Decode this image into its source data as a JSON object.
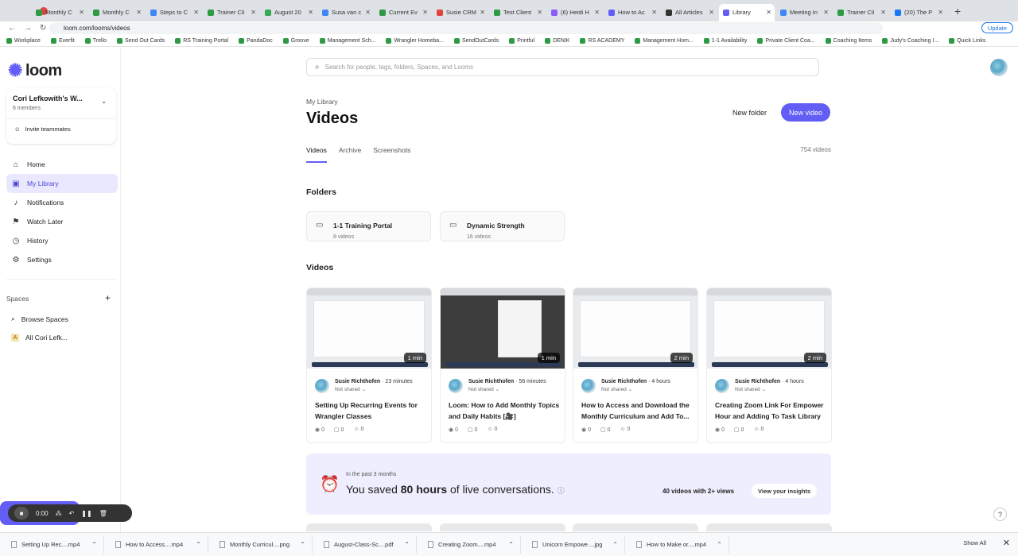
{
  "browser": {
    "tabs": [
      {
        "label": "Monthly C",
        "color": "#2e9a44",
        "active": false
      },
      {
        "label": "Monthly C",
        "color": "#2e9a44",
        "active": false
      },
      {
        "label": "Steps to C",
        "color": "#4285f4",
        "active": false
      },
      {
        "label": "Trainer Cli",
        "color": "#2e9a44",
        "active": false
      },
      {
        "label": "August 20",
        "color": "#34a853",
        "active": false
      },
      {
        "label": "Susa van c",
        "color": "#4285f4",
        "active": false
      },
      {
        "label": "Current Ev",
        "color": "#2e9a44",
        "active": false
      },
      {
        "label": "Susie CRM",
        "color": "#e0443e",
        "active": false
      },
      {
        "label": "Test Client",
        "color": "#2e9a44",
        "active": false
      },
      {
        "label": "(6) Heidi H",
        "color": "#8b5cf6",
        "active": false
      },
      {
        "label": "How to Ac",
        "color": "#625df5",
        "active": false
      },
      {
        "label": "All Articles",
        "color": "#333333",
        "active": false
      },
      {
        "label": "Library",
        "color": "#625df5",
        "active": true
      },
      {
        "label": "Meeting In",
        "color": "#4285f4",
        "active": false
      },
      {
        "label": "Trainer Cli",
        "color": "#2e9a44",
        "active": false
      },
      {
        "label": "(20) The P",
        "color": "#1877f2",
        "active": false
      }
    ],
    "new_tab": "+",
    "url": "loom.com/looms/videos",
    "update_label": "Update",
    "bookmarks": [
      "Workplace",
      "Everfit",
      "Trello",
      "Send Out Cards",
      "RS Training Portal",
      "PandaDoc",
      "Groove",
      "Management Sch...",
      "Wrangler Homeba...",
      "SendOutCards",
      "Printful",
      "DENIK",
      "RS ACADEMY",
      "Management Hom...",
      "1-1 Availability",
      "Private Client Coa...",
      "Coaching Items",
      "Judy's Coaching I...",
      "Quick Links"
    ]
  },
  "sidebar": {
    "logo_text": "loom",
    "workspace_name": "Cori Lefkowith's W...",
    "workspace_members": "6 members",
    "invite_label": "Invite teammates",
    "nav": [
      {
        "label": "Home",
        "icon": "home-icon",
        "glyph": "⌂"
      },
      {
        "label": "My Library",
        "icon": "library-icon",
        "glyph": "▣"
      },
      {
        "label": "Notifications",
        "icon": "bell-icon",
        "glyph": "♪"
      },
      {
        "label": "Watch Later",
        "icon": "bookmark-icon",
        "glyph": "⚑"
      },
      {
        "label": "History",
        "icon": "history-icon",
        "glyph": "◷"
      },
      {
        "label": "Settings",
        "icon": "gear-icon",
        "glyph": "⚙"
      }
    ],
    "spaces_header": "Spaces",
    "browse_spaces": "Browse Spaces",
    "all_space_letter": "A",
    "all_space": "All Cori Lefk..."
  },
  "recorder": {
    "time": "0:00"
  },
  "main": {
    "search_placeholder": "Search for people, tags, folders, Spaces, and Looms",
    "breadcrumb": "My Library",
    "title": "Videos",
    "new_folder": "New folder",
    "new_video": "New video",
    "tabs": [
      "Videos",
      "Archive",
      "Screenshots"
    ],
    "video_count": "754 videos",
    "folders_header": "Folders",
    "folders": [
      {
        "name": "1-1 Training Portal",
        "count": "8 videos"
      },
      {
        "name": "Dynamic Strength",
        "count": "16 videos"
      }
    ],
    "videos_header": "Videos",
    "videos": [
      {
        "duration": "1 min",
        "author": "Susie Richthofen",
        "time": "23 minutes",
        "shared": "Not shared",
        "title": "Setting Up Recurring Events for Wrangler Classes",
        "views": "0",
        "comments": "0",
        "reactions": "0"
      },
      {
        "duration": "1 min",
        "author": "Susie Richthofen",
        "time": "56 minutes",
        "shared": "Not shared",
        "title": "Loom: How to Add Monthly Topics and Daily Habits [🎥]",
        "views": "0",
        "comments": "0",
        "reactions": "0"
      },
      {
        "duration": "2 min",
        "author": "Susie Richthofen",
        "time": "4 hours",
        "shared": "Not shared",
        "title": "How to Access and Download the Monthly Curriculum and Add To...",
        "views": "0",
        "comments": "0",
        "reactions": "0"
      },
      {
        "duration": "2 min",
        "author": "Susie Richthofen",
        "time": "4 hours",
        "shared": "Not shared",
        "title": "Creating Zoom Link For Empower Hour and Adding To Task Library",
        "views": "0",
        "comments": "0",
        "reactions": "0"
      }
    ],
    "banner": {
      "small": "In the past 3 months",
      "prefix": "You saved ",
      "hours": "80 hours",
      "suffix": " of live conversations.",
      "views": "40 videos with 2+ views",
      "insights": "View your insights"
    }
  },
  "downloads": {
    "items": [
      "Setting Up Rec....mp4",
      "How to Access....mp4",
      "Monthly Curricul....png",
      "August-Class-Sc....pdf",
      "Creating Zoom....mp4",
      "Unicorn Empowe....jpg",
      "How to Make or....mp4"
    ],
    "show_all": "Show All"
  }
}
